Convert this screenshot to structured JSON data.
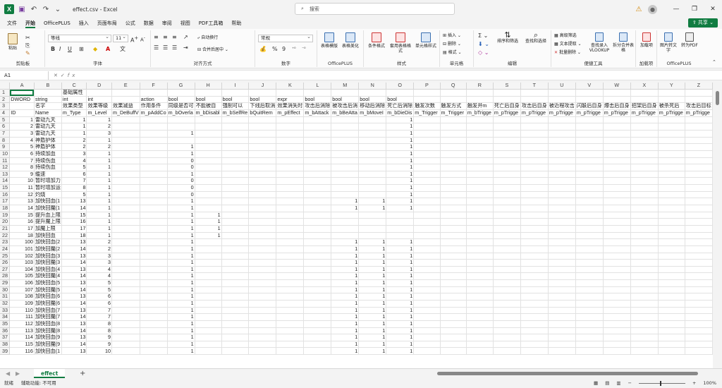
{
  "window": {
    "title": "effect.csv  -  Excel"
  },
  "search": {
    "placeholder": "搜索"
  },
  "menus": [
    "文件",
    "开始",
    "OfficePLUS",
    "插入",
    "页面布局",
    "公式",
    "数据",
    "审阅",
    "视图",
    "PDF工具箱",
    "帮助"
  ],
  "share_label": "共享",
  "ribbon": {
    "clipboard": {
      "paste": "粘贴",
      "label": "剪贴板"
    },
    "font": {
      "name": "等线",
      "size": "11",
      "label": "字体",
      "bold": "B",
      "italic": "I",
      "underline": "U",
      "grow": "A",
      "shrink": "A",
      "fontcolor": "A"
    },
    "align": {
      "wrap": "自动换行",
      "merge": "合并后居中",
      "label": "对齐方式"
    },
    "number": {
      "format": "常规",
      "label": "数字",
      "percent": "%",
      "comma": "9"
    },
    "officeplus1": {
      "b1": "表格模版",
      "b2": "表格美化",
      "label": "OfficePLUS"
    },
    "styles": {
      "cond": "条件格式",
      "table": "套用表格格式",
      "cell": "单元格样式",
      "label": "样式"
    },
    "cells": {
      "insert": "插入",
      "delete": "删除",
      "format": "格式",
      "label": "单元格"
    },
    "editing": {
      "sort": "排序和筛选",
      "find": "查找和选择",
      "label": "编辑"
    },
    "convenient": {
      "adv": "高级筛选",
      "extract": "文本提取",
      "batch": "批量删除",
      "vlookup": "查找录入VLOOKUP",
      "split": "拆分合并表格",
      "label": "便捷工具"
    },
    "addins": {
      "b1": "加载项",
      "label": "加载项"
    },
    "officeplus2": {
      "b1": "图片转文字",
      "b2": "转为PDF",
      "label": "OfficePLUS"
    }
  },
  "formula_bar": {
    "name_box": "A1",
    "fx": "fx",
    "content": ""
  },
  "columns": [
    "A",
    "B",
    "C",
    "D",
    "E",
    "F",
    "G",
    "H",
    "I",
    "J",
    "K",
    "L",
    "M",
    "N",
    "O",
    "P",
    "Q",
    "R",
    "S",
    "T",
    "U",
    "V",
    "W",
    "X",
    "Y",
    "Z"
  ],
  "rows": [
    {
      "n": "1",
      "c": [
        "",
        "",
        "基础属性",
        "",
        "",
        "",
        "",
        "",
        "",
        "",
        "",
        "",
        "",
        "",
        "",
        "",
        "",
        "",
        "",
        "",
        "",
        "",
        "",
        "",
        "",
        ""
      ]
    },
    {
      "n": "2",
      "c": [
        "DWORD",
        "string",
        "int",
        "int",
        "",
        "action",
        "bool",
        "bool",
        "bool",
        "bool",
        "expr",
        "bool",
        "bool",
        "bool",
        "bool",
        "",
        "",
        "",
        "",
        "",
        "",
        "",
        "",
        "",
        "",
        ""
      ]
    },
    {
      "n": "3",
      "c": [
        "",
        "名字",
        "效果类型",
        "效果等级",
        "效果减益",
        "作用条件",
        "同级是否可",
        "不能被自",
        "强制可以",
        "下线后取消",
        "效果消失时",
        "攻击后消除",
        "被攻击后消",
        "移动后消除",
        "死亡后消除",
        "触发次数",
        "触发方式",
        "触发并m",
        "死亡后自身",
        "攻击后自身",
        "被近程攻击",
        "闪躲后自身",
        "爆击后自身",
        "招架后自身",
        "被杀死后",
        "攻击后目标"
      ]
    },
    {
      "n": "4",
      "c": [
        "ID",
        "Name",
        "m_Type",
        "m_Level",
        "m_DeBuffV",
        "m_pAddCo",
        "m_bOverla",
        "m_bDisabl",
        "m_bSelfRe",
        "bQuitRem",
        "m_pEffect",
        "m_bAttack",
        "m_bBeAtta",
        "m_bMoveI",
        "m_bDieDis",
        "m_Trigger",
        "m_Trigger",
        "m_bTrigge",
        "m_pTrigge",
        "m_pTrigge",
        "m_pTrigge",
        "m_pTrigge",
        "m_pTrigge",
        "m_pTrigge",
        "m_pTrigge",
        "m_pTrigge"
      ]
    },
    {
      "n": "5",
      "c": [
        "1",
        "雷动九天",
        "1",
        "1",
        "",
        "",
        "",
        "",
        "",
        "",
        "",
        "",
        "",
        "",
        "1",
        "",
        "",
        "",
        "",
        "",
        "",
        "",
        "",
        "",
        "",
        ""
      ]
    },
    {
      "n": "6",
      "c": [
        "2",
        "雷动九天",
        "1",
        "2",
        "",
        "",
        "",
        "",
        "",
        "",
        "",
        "",
        "",
        "",
        "1",
        "",
        "",
        "",
        "",
        "",
        "",
        "",
        "",
        "",
        "",
        ""
      ]
    },
    {
      "n": "7",
      "c": [
        "3",
        "雷动九天",
        "1",
        "3",
        "",
        "",
        "1",
        "",
        "",
        "",
        "",
        "",
        "",
        "",
        "1",
        "",
        "",
        "",
        "",
        "",
        "",
        "",
        "",
        "",
        "",
        ""
      ]
    },
    {
      "n": "8",
      "c": [
        "4",
        "神盾护体",
        "2",
        "1",
        "",
        "",
        "",
        "",
        "",
        "",
        "",
        "",
        "",
        "",
        "1",
        "",
        "",
        "",
        "",
        "",
        "",
        "",
        "",
        "",
        "",
        ""
      ]
    },
    {
      "n": "9",
      "c": [
        "5",
        "神盾护体",
        "2",
        "2",
        "",
        "",
        "1",
        "",
        "",
        "",
        "",
        "",
        "",
        "",
        "1",
        "",
        "",
        "",
        "",
        "",
        "",
        "",
        "",
        "",
        "",
        ""
      ]
    },
    {
      "n": "10",
      "c": [
        "6",
        "持续加血",
        "3",
        "1",
        "",
        "",
        "1",
        "",
        "",
        "",
        "",
        "",
        "",
        "",
        "1",
        "",
        "",
        "",
        "",
        "",
        "",
        "",
        "",
        "",
        "",
        ""
      ]
    },
    {
      "n": "11",
      "c": [
        "7",
        "持续伤血",
        "4",
        "1",
        "",
        "",
        "0",
        "",
        "",
        "",
        "",
        "",
        "",
        "",
        "1",
        "",
        "",
        "",
        "",
        "",
        "",
        "",
        "",
        "",
        "",
        ""
      ]
    },
    {
      "n": "12",
      "c": [
        "8",
        "持续伤血",
        "5",
        "1",
        "",
        "",
        "0",
        "",
        "",
        "",
        "",
        "",
        "",
        "",
        "1",
        "",
        "",
        "",
        "",
        "",
        "",
        "",
        "",
        "",
        "",
        ""
      ]
    },
    {
      "n": "13",
      "c": [
        "9",
        "缓速",
        "6",
        "1",
        "",
        "",
        "1",
        "",
        "",
        "",
        "",
        "",
        "",
        "",
        "1",
        "",
        "",
        "",
        "",
        "",
        "",
        "",
        "",
        "",
        "",
        ""
      ]
    },
    {
      "n": "14",
      "c": [
        "10",
        "暂时增加力",
        "7",
        "1",
        "",
        "",
        "0",
        "",
        "",
        "",
        "",
        "",
        "",
        "",
        "1",
        "",
        "",
        "",
        "",
        "",
        "",
        "",
        "",
        "",
        "",
        ""
      ]
    },
    {
      "n": "15",
      "c": [
        "11",
        "暂时增加运",
        "8",
        "1",
        "",
        "",
        "0",
        "",
        "",
        "",
        "",
        "",
        "",
        "",
        "1",
        "",
        "",
        "",
        "",
        "",
        "",
        "",
        "",
        "",
        "",
        ""
      ]
    },
    {
      "n": "16",
      "c": [
        "12",
        "灼烧",
        "5",
        "1",
        "",
        "",
        "0",
        "",
        "",
        "",
        "",
        "",
        "",
        "",
        "1",
        "",
        "",
        "",
        "",
        "",
        "",
        "",
        "",
        "",
        "",
        ""
      ]
    },
    {
      "n": "17",
      "c": [
        "13",
        "加快回血(1",
        "13",
        "1",
        "",
        "",
        "1",
        "",
        "",
        "",
        "",
        "",
        "1",
        "1",
        "1",
        "",
        "",
        "",
        "",
        "",
        "",
        "",
        "",
        "",
        "",
        ""
      ]
    },
    {
      "n": "18",
      "c": [
        "14",
        "加快回魔(1",
        "14",
        "1",
        "",
        "",
        "1",
        "",
        "",
        "",
        "",
        "",
        "1",
        "1",
        "1",
        "",
        "",
        "",
        "",
        "",
        "",
        "",
        "",
        "",
        "",
        ""
      ]
    },
    {
      "n": "19",
      "c": [
        "15",
        "提升血上限",
        "15",
        "1",
        "",
        "",
        "1",
        "1",
        "",
        "",
        "",
        "",
        "",
        "",
        "",
        "",
        "",
        "",
        "",
        "",
        "",
        "",
        "",
        "",
        "",
        ""
      ]
    },
    {
      "n": "20",
      "c": [
        "16",
        "提升魔上限",
        "16",
        "1",
        "",
        "",
        "1",
        "1",
        "",
        "",
        "",
        "",
        "",
        "",
        "",
        "",
        "",
        "",
        "",
        "",
        "",
        "",
        "",
        "",
        "",
        ""
      ]
    },
    {
      "n": "21",
      "c": [
        "17",
        "加魔上限",
        "17",
        "1",
        "",
        "",
        "1",
        "1",
        "",
        "",
        "",
        "",
        "",
        "",
        "",
        "",
        "",
        "",
        "",
        "",
        "",
        "",
        "",
        "",
        "",
        ""
      ]
    },
    {
      "n": "22",
      "c": [
        "18",
        "加快回血",
        "18",
        "1",
        "",
        "",
        "1",
        "1",
        "",
        "",
        "",
        "",
        "",
        "",
        "",
        "",
        "",
        "",
        "",
        "",
        "",
        "",
        "",
        "",
        "",
        ""
      ]
    },
    {
      "n": "23",
      "c": [
        "100",
        "加快回血(2",
        "13",
        "2",
        "",
        "",
        "1",
        "",
        "",
        "",
        "",
        "",
        "1",
        "1",
        "1",
        "",
        "",
        "",
        "",
        "",
        "",
        "",
        "",
        "",
        "",
        ""
      ]
    },
    {
      "n": "24",
      "c": [
        "101",
        "加快回魔(2",
        "14",
        "2",
        "",
        "",
        "1",
        "",
        "",
        "",
        "",
        "",
        "1",
        "1",
        "1",
        "",
        "",
        "",
        "",
        "",
        "",
        "",
        "",
        "",
        "",
        ""
      ]
    },
    {
      "n": "25",
      "c": [
        "102",
        "加快回血(3",
        "13",
        "3",
        "",
        "",
        "1",
        "",
        "",
        "",
        "",
        "",
        "1",
        "1",
        "1",
        "",
        "",
        "",
        "",
        "",
        "",
        "",
        "",
        "",
        "",
        ""
      ]
    },
    {
      "n": "26",
      "c": [
        "103",
        "加快回魔(3",
        "14",
        "3",
        "",
        "",
        "1",
        "",
        "",
        "",
        "",
        "",
        "1",
        "1",
        "1",
        "",
        "",
        "",
        "",
        "",
        "",
        "",
        "",
        "",
        "",
        ""
      ]
    },
    {
      "n": "27",
      "c": [
        "104",
        "加快回血(4",
        "13",
        "4",
        "",
        "",
        "1",
        "",
        "",
        "",
        "",
        "",
        "1",
        "1",
        "1",
        "",
        "",
        "",
        "",
        "",
        "",
        "",
        "",
        "",
        "",
        ""
      ]
    },
    {
      "n": "28",
      "c": [
        "105",
        "加快回魔(4",
        "14",
        "4",
        "",
        "",
        "1",
        "",
        "",
        "",
        "",
        "",
        "1",
        "1",
        "1",
        "",
        "",
        "",
        "",
        "",
        "",
        "",
        "",
        "",
        "",
        ""
      ]
    },
    {
      "n": "29",
      "c": [
        "106",
        "加快回血(5",
        "13",
        "5",
        "",
        "",
        "1",
        "",
        "",
        "",
        "",
        "",
        "1",
        "1",
        "1",
        "",
        "",
        "",
        "",
        "",
        "",
        "",
        "",
        "",
        "",
        ""
      ]
    },
    {
      "n": "30",
      "c": [
        "107",
        "加快回魔(5",
        "14",
        "5",
        "",
        "",
        "1",
        "",
        "",
        "",
        "",
        "",
        "1",
        "1",
        "1",
        "",
        "",
        "",
        "",
        "",
        "",
        "",
        "",
        "",
        "",
        ""
      ]
    },
    {
      "n": "31",
      "c": [
        "108",
        "加快回血(6",
        "13",
        "6",
        "",
        "",
        "1",
        "",
        "",
        "",
        "",
        "",
        "1",
        "1",
        "1",
        "",
        "",
        "",
        "",
        "",
        "",
        "",
        "",
        "",
        "",
        ""
      ]
    },
    {
      "n": "32",
      "c": [
        "109",
        "加快回魔(6",
        "14",
        "6",
        "",
        "",
        "1",
        "",
        "",
        "",
        "",
        "",
        "1",
        "1",
        "1",
        "",
        "",
        "",
        "",
        "",
        "",
        "",
        "",
        "",
        "",
        ""
      ]
    },
    {
      "n": "33",
      "c": [
        "110",
        "加快回血(7",
        "13",
        "7",
        "",
        "",
        "1",
        "",
        "",
        "",
        "",
        "",
        "1",
        "1",
        "1",
        "",
        "",
        "",
        "",
        "",
        "",
        "",
        "",
        "",
        "",
        ""
      ]
    },
    {
      "n": "34",
      "c": [
        "111",
        "加快回魔(7",
        "14",
        "7",
        "",
        "",
        "1",
        "",
        "",
        "",
        "",
        "",
        "1",
        "1",
        "1",
        "",
        "",
        "",
        "",
        "",
        "",
        "",
        "",
        "",
        "",
        ""
      ]
    },
    {
      "n": "35",
      "c": [
        "112",
        "加快回血(8",
        "13",
        "8",
        "",
        "",
        "1",
        "",
        "",
        "",
        "",
        "",
        "1",
        "1",
        "1",
        "",
        "",
        "",
        "",
        "",
        "",
        "",
        "",
        "",
        "",
        ""
      ]
    },
    {
      "n": "36",
      "c": [
        "113",
        "加快回魔(8",
        "14",
        "8",
        "",
        "",
        "1",
        "",
        "",
        "",
        "",
        "",
        "1",
        "1",
        "1",
        "",
        "",
        "",
        "",
        "",
        "",
        "",
        "",
        "",
        "",
        ""
      ]
    },
    {
      "n": "37",
      "c": [
        "114",
        "加快回血(9",
        "13",
        "9",
        "",
        "",
        "1",
        "",
        "",
        "",
        "",
        "",
        "1",
        "1",
        "1",
        "",
        "",
        "",
        "",
        "",
        "",
        "",
        "",
        "",
        "",
        ""
      ]
    },
    {
      "n": "38",
      "c": [
        "115",
        "加快回魔(9",
        "14",
        "9",
        "",
        "",
        "1",
        "",
        "",
        "",
        "",
        "",
        "1",
        "1",
        "1",
        "",
        "",
        "",
        "",
        "",
        "",
        "",
        "",
        "",
        "",
        ""
      ]
    },
    {
      "n": "39",
      "c": [
        "116",
        "加快回血(1",
        "13",
        "10",
        "",
        "",
        "1",
        "",
        "",
        "",
        "",
        "",
        "1",
        "1",
        "1",
        "",
        "",
        "",
        "",
        "",
        "",
        "",
        "",
        "",
        "",
        ""
      ]
    }
  ],
  "sheet_tab": "effect",
  "status": {
    "ready": "就绪",
    "accessibility": "辅助功能: 不可用",
    "zoom": "100%"
  }
}
